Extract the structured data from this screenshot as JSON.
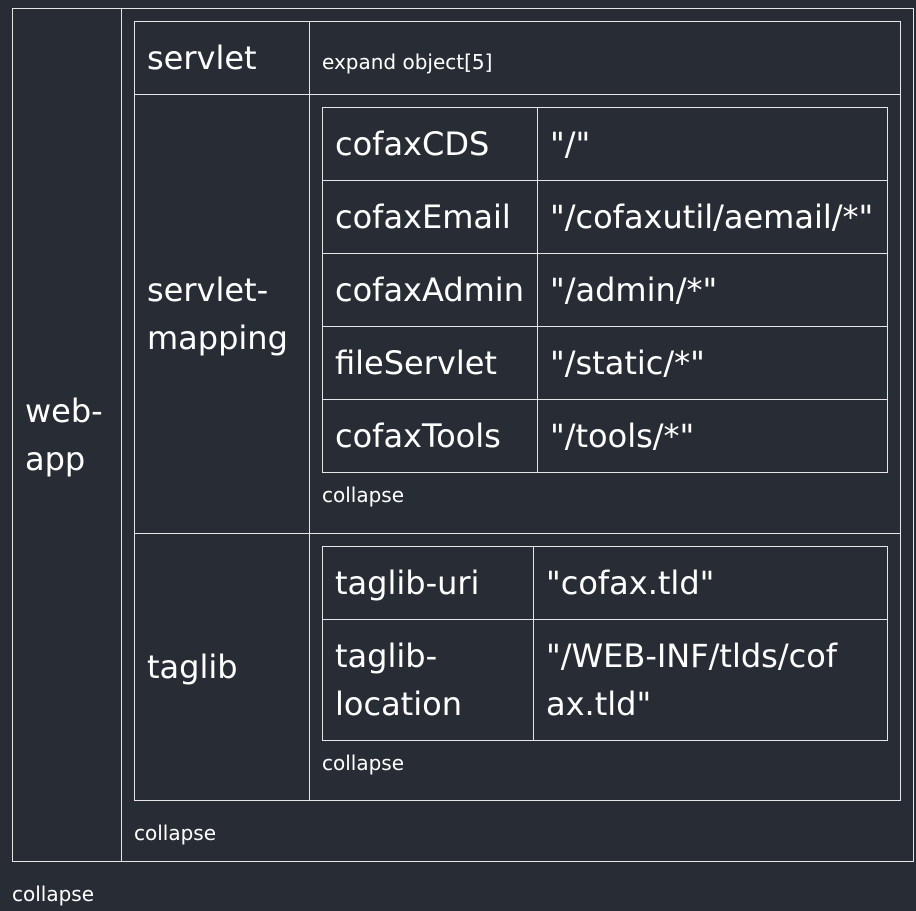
{
  "root": {
    "key": "web-app",
    "collapse_label": "collapse",
    "entries": [
      {
        "key": "servlet",
        "expand_label": "expand object[5]"
      },
      {
        "key": "servlet-mapping",
        "collapse_label": "collapse",
        "rows": [
          {
            "key": "cofaxCDS",
            "value": "\"/\""
          },
          {
            "key": "cofaxEmail",
            "value": "\"/cofaxutil/aemail/*\""
          },
          {
            "key": "cofaxAdmin",
            "value": "\"/admin/*\""
          },
          {
            "key": "fileServlet",
            "value": "\"/static/*\""
          },
          {
            "key": "cofaxTools",
            "value": "\"/tools/*\""
          }
        ]
      },
      {
        "key": "taglib",
        "collapse_label": "collapse",
        "rows": [
          {
            "key": "taglib-uri",
            "value": "\"cofax.tld\""
          },
          {
            "key": "taglib-location",
            "value": "\"/WEB-INF/tlds/cofax.tld\""
          }
        ]
      }
    ]
  },
  "footer_collapse_label": "collapse"
}
